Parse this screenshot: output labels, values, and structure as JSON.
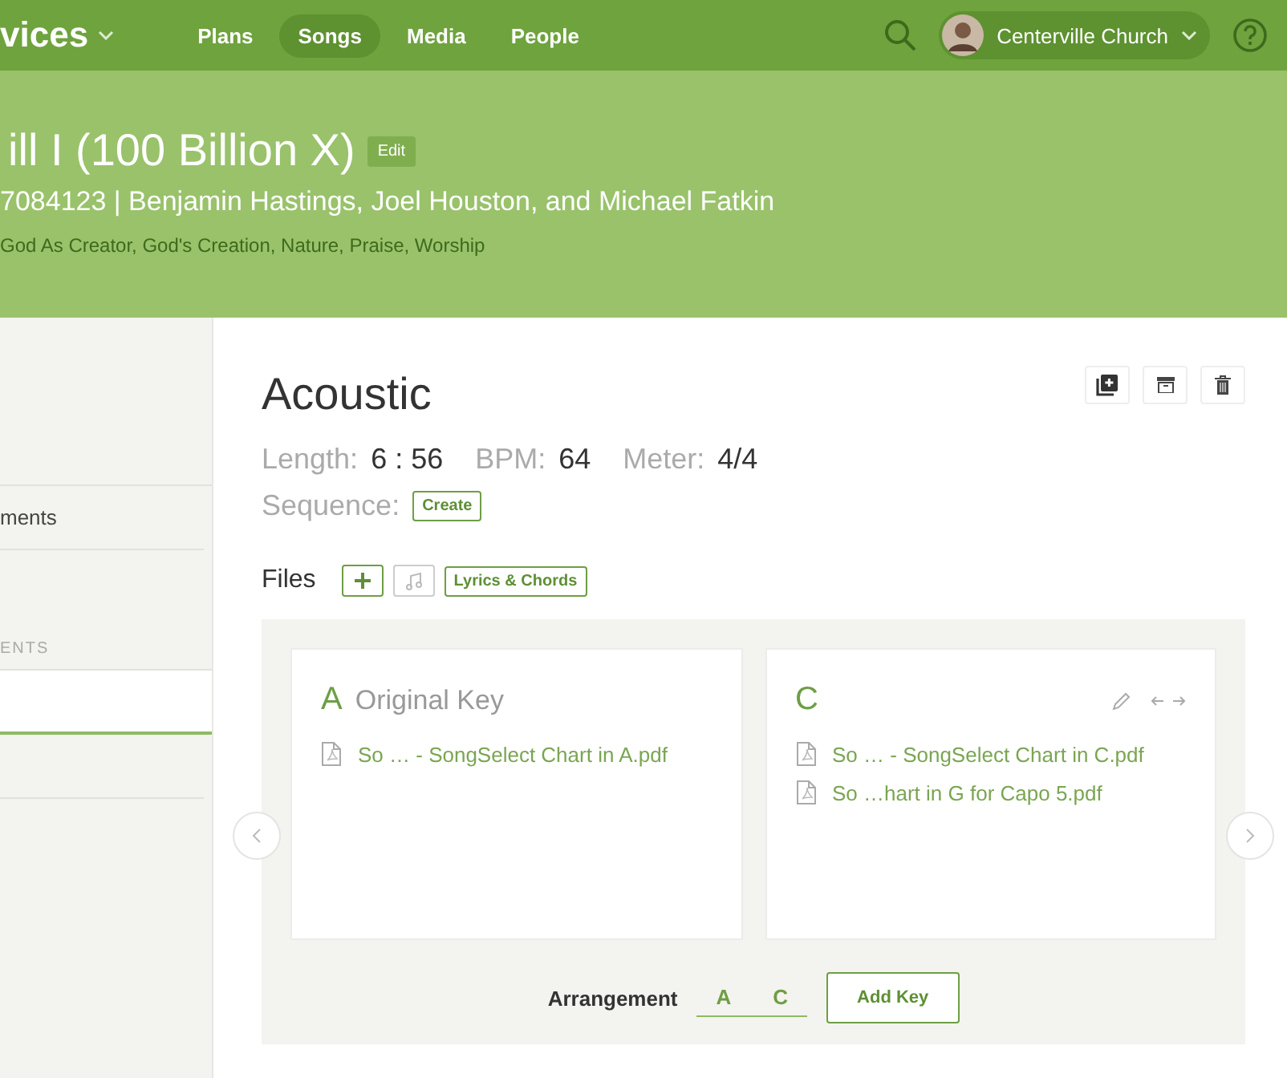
{
  "nav": {
    "brand": "vices",
    "links": [
      {
        "label": "Plans",
        "selected": false
      },
      {
        "label": "Songs",
        "selected": true
      },
      {
        "label": "Media",
        "selected": false
      },
      {
        "label": "People",
        "selected": false
      }
    ],
    "account": "Centerville Church"
  },
  "song": {
    "title": "ill I (100 Billion X)",
    "edit": "Edit",
    "credits": "7084123 | Benjamin Hastings, Joel Houston, and Michael Fatkin",
    "themes": "God As Creator, God's Creation, Nature, Praise, Worship"
  },
  "sidebar": {
    "items": [
      {
        "label": "ments"
      }
    ],
    "section": "ENTS"
  },
  "arrangement": {
    "name": "Acoustic",
    "length_label": "Length:",
    "length": "6 : 56",
    "bpm_label": "BPM:",
    "bpm": "64",
    "meter_label": "Meter:",
    "meter": "4/4",
    "sequence_label": "Sequence:",
    "sequence_button": "Create",
    "files_label": "Files",
    "files_button": "Lyrics & Chords",
    "keys": [
      {
        "key": "A",
        "name": "Original Key",
        "editable": false,
        "files": [
          "So … - SongSelect Chart in A.pdf"
        ]
      },
      {
        "key": "C",
        "editable": true,
        "files": [
          "So … - SongSelect Chart in C.pdf",
          "So …hart in G for Capo 5.pdf"
        ]
      }
    ],
    "footer_label": "Arrangement",
    "key_tabs": [
      "A",
      "C"
    ],
    "add_key": "Add Key"
  }
}
